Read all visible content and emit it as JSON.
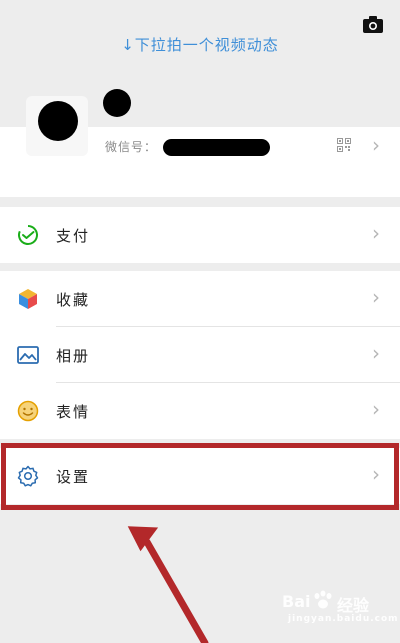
{
  "header": {
    "pull_hint": "↓下拉拍一个视频动态",
    "camera_icon": "camera-icon"
  },
  "profile": {
    "wechat_id_label": "微信号：",
    "qr_icon": "qr-code-icon",
    "chevron": "›"
  },
  "menu": {
    "pay": {
      "label": "支付",
      "icon": "pay-icon",
      "color": "#1aad19"
    },
    "favorites": {
      "label": "收藏",
      "icon": "cube-icon"
    },
    "album": {
      "label": "相册",
      "icon": "image-icon",
      "color": "#2b6cb0"
    },
    "stickers": {
      "label": "表情",
      "icon": "smile-icon",
      "color": "#e5a000"
    },
    "settings": {
      "label": "设置",
      "icon": "gear-icon",
      "color": "#2b6cb0"
    }
  },
  "annotation": {
    "highlight_color": "#b3282a"
  },
  "watermark": {
    "brand": "Bai",
    "brand_suffix": "经验",
    "domain": "jingyan.baidu.com"
  }
}
